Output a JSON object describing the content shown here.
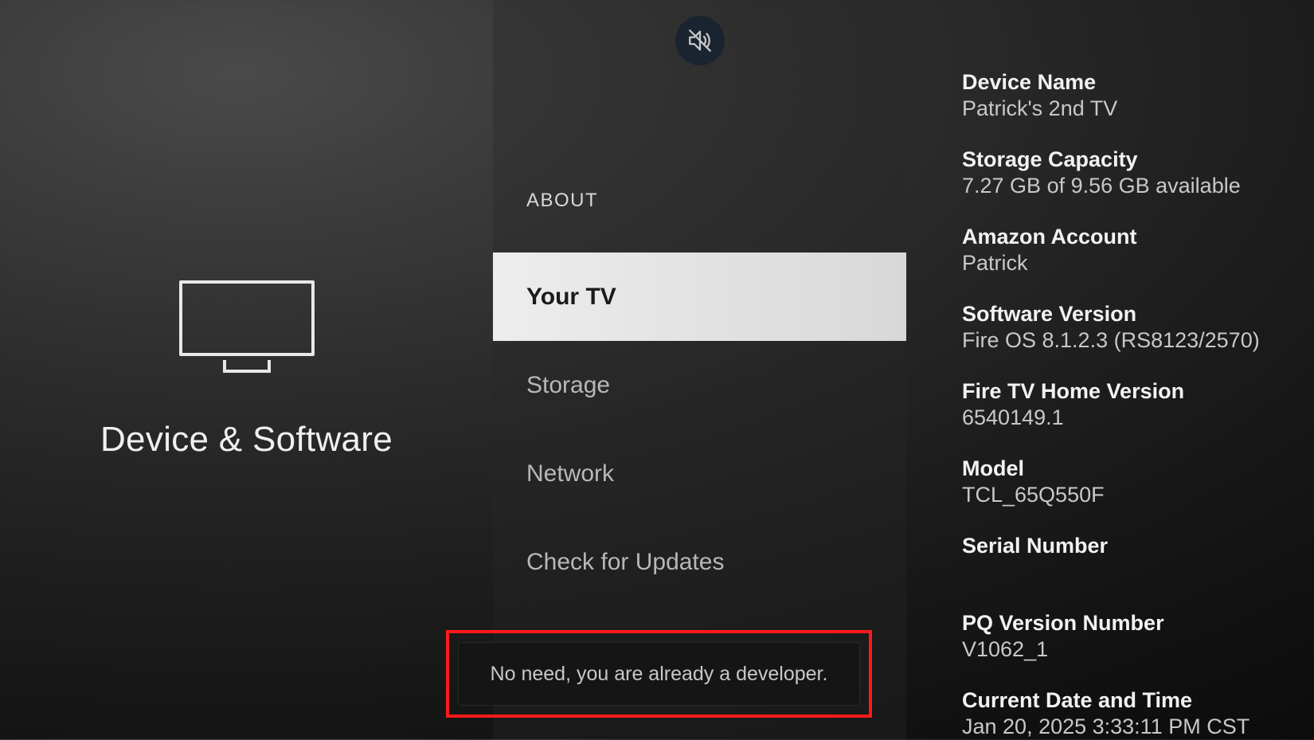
{
  "page": {
    "title": "Device & Software"
  },
  "menu": {
    "header": "ABOUT",
    "items": [
      {
        "label": "Your TV",
        "selected": true
      },
      {
        "label": "Storage",
        "selected": false
      },
      {
        "label": "Network",
        "selected": false
      },
      {
        "label": "Check for Updates",
        "selected": false
      }
    ]
  },
  "details": [
    {
      "label": "Device Name",
      "value": "Patrick's 2nd TV"
    },
    {
      "label": "Storage Capacity",
      "value": "7.27 GB of 9.56 GB available"
    },
    {
      "label": "Amazon Account",
      "value": "Patrick"
    },
    {
      "label": "Software Version",
      "value": "Fire OS 8.1.2.3 (RS8123/2570)"
    },
    {
      "label": "Fire TV Home Version",
      "value": "6540149.1"
    },
    {
      "label": "Model",
      "value": "TCL_65Q550F"
    },
    {
      "label": "Serial Number",
      "value": ""
    },
    {
      "label": "PQ Version Number",
      "value": "V1062_1"
    },
    {
      "label": "Current Date and Time",
      "value": "Jan 20, 2025 3:33:11 PM CST"
    }
  ],
  "toast": {
    "message": "No need, you are already a developer."
  }
}
